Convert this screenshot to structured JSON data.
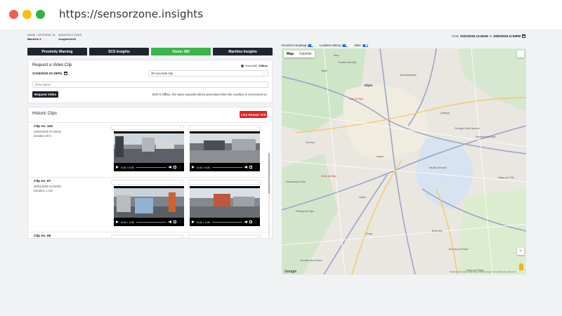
{
  "browser": {
    "url": "https://sensorzone.insights"
  },
  "machine": {
    "name_label": "NAME / INTERNAL ID",
    "name_value": "Machine 3",
    "manufacturer_label": "MANUFACTURER",
    "manufacturer_value": "Jungheinrich"
  },
  "tabs": [
    {
      "label": "Proximity Warning",
      "active": false
    },
    {
      "label": "SCS Insights",
      "active": false
    },
    {
      "label": "Vision 360",
      "active": true
    },
    {
      "label": "Machine Insights",
      "active": false
    }
  ],
  "request": {
    "title": "Request a Video Clip",
    "device_name": "Vision360",
    "device_status": "Offline",
    "datetime": "21/05/2025 02:29PM",
    "duration_option": "30 seconds clip",
    "description_placeholder": "Description",
    "button_label": "Request Video",
    "offline_note": "DVR is Offline, the video requests will be processed when the machine is next turned on."
  },
  "historic": {
    "title": "Historic Clips",
    "live_button": "Live Stream: 9-8",
    "clips": [
      {
        "name": "Clip no. 104",
        "timestamp": "20/02/2025 07:49AM",
        "duration": "Duration 30 s",
        "videos": [
          {
            "time": "0:00 / 0:00"
          },
          {
            "time": "0:00 / 0:00"
          }
        ]
      },
      {
        "name": "Clip no. 97",
        "timestamp": "30/01/2025 02:54PM",
        "duration": "Duration 1 min",
        "videos": [
          {
            "time": "0:00 / 1:00"
          },
          {
            "time": "0:00 / 1:00"
          }
        ]
      },
      {
        "name": "Clip no. 96"
      }
    ]
  },
  "range": {
    "from_label": "From",
    "from": "01/01/2025 12:00AM",
    "to_label": "to",
    "to": "30/05/2025 11:59PM"
  },
  "map_toggles": [
    {
      "label": "Incursion Heatmap",
      "on": true
    },
    {
      "label": "Location History",
      "on": true
    },
    {
      "label": "Sites",
      "on": true
    }
  ],
  "map": {
    "type_map": "Map",
    "type_satellite": "Satellite",
    "google_label": "Google",
    "attribution": "Keyboard shortcuts   Map data ©2025 Google   Terms   Report a map error",
    "places": [
      {
        "name": "Dijon",
        "big": true,
        "red": false
      },
      {
        "name": "Fontaine-lès-Dijon",
        "big": false,
        "red": false
      },
      {
        "name": "Saint-Apollinaire",
        "big": false,
        "red": false
      },
      {
        "name": "Talant",
        "big": false,
        "red": false
      },
      {
        "name": "Ahuy",
        "big": false,
        "red": false
      },
      {
        "name": "Quetigny",
        "big": false,
        "red": false
      },
      {
        "name": "Chevigny-Saint-Sauveur",
        "big": false,
        "red": false
      },
      {
        "name": "Sennecey-lès-Dijon",
        "big": false,
        "red": false
      },
      {
        "name": "Chenôve",
        "big": false,
        "red": false
      },
      {
        "name": "Longvic",
        "big": false,
        "red": false
      },
      {
        "name": "Neuilly-Crimolois",
        "big": false,
        "red": false
      },
      {
        "name": "Marsannay-la-Côte",
        "big": false,
        "red": false
      },
      {
        "name": "Perrigny-lès-Dijon",
        "big": false,
        "red": false
      },
      {
        "name": "Ouges",
        "big": false,
        "red": false
      },
      {
        "name": "Fénay",
        "big": false,
        "red": false
      },
      {
        "name": "Bretenière",
        "big": false,
        "red": false
      },
      {
        "name": "Rouvres-en-Plaine",
        "big": false,
        "red": false
      },
      {
        "name": "Thorey-en-Plaine",
        "big": false,
        "red": false
      },
      {
        "name": "Magny-sur-Tille",
        "big": false,
        "red": false
      },
      {
        "name": "Corcelles-lès-Cîteaux",
        "big": false,
        "red": false
      },
      {
        "name": "Zénith de Dijon",
        "big": false,
        "red": true
      },
      {
        "name": "Gare de Dijon",
        "big": false,
        "red": true
      }
    ]
  }
}
